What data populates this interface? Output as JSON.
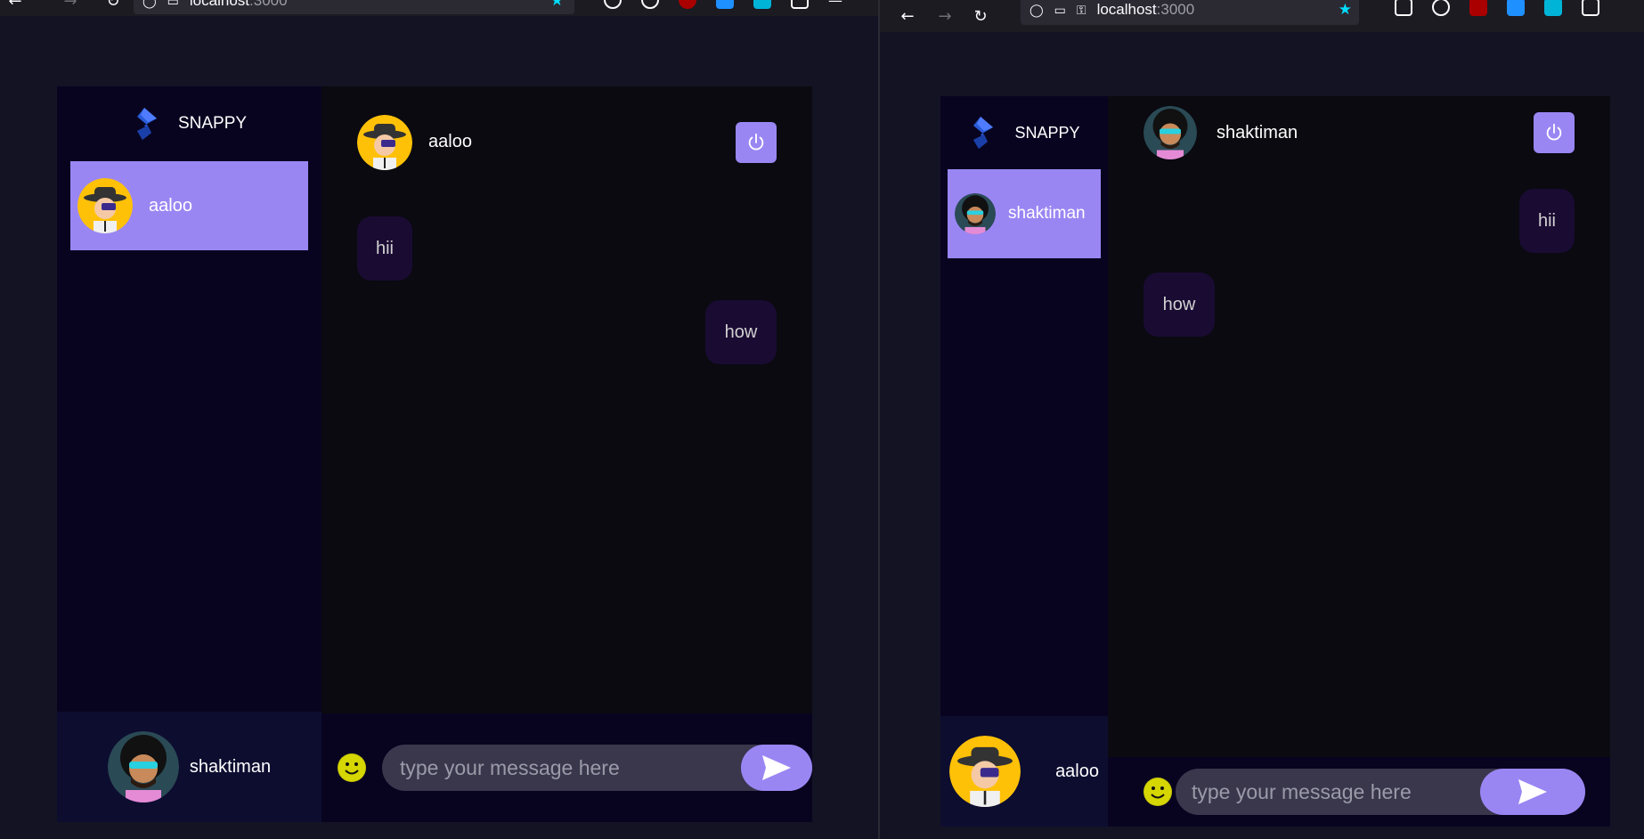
{
  "left": {
    "url_host": "localhost",
    "url_port": ":3000",
    "brand": "SNAPPY",
    "contacts": [
      {
        "name": "aaloo",
        "avatar": "aaloo-avatar"
      }
    ],
    "chat_user": "aaloo",
    "messages": [
      {
        "text": "hii",
        "direction": "received"
      },
      {
        "text": "how",
        "direction": "sent"
      }
    ],
    "current_user": "shaktiman",
    "input_placeholder": "type your message here"
  },
  "right": {
    "url_host": "localhost",
    "url_port": ":3000",
    "brand": "SNAPPY",
    "contacts": [
      {
        "name": "shaktiman",
        "avatar": "shaktiman-avatar"
      }
    ],
    "chat_user": "shaktiman",
    "messages": [
      {
        "text": "hii",
        "direction": "sent"
      },
      {
        "text": "how",
        "direction": "received"
      }
    ],
    "current_user": "aaloo",
    "input_placeholder": "type your message here"
  },
  "colors": {
    "accent": "#9a86f3",
    "sidebar_bg": "#080420",
    "chat_bg": "#0a0a10",
    "bubble_bg": "#1a0b33",
    "page_bg": "#131324"
  },
  "icons": [
    "snappy-logo-icon",
    "power-icon",
    "emoji-icon",
    "send-icon",
    "back-icon",
    "forward-icon",
    "reload-icon",
    "shield-icon",
    "page-icon",
    "key-icon",
    "star-icon"
  ]
}
